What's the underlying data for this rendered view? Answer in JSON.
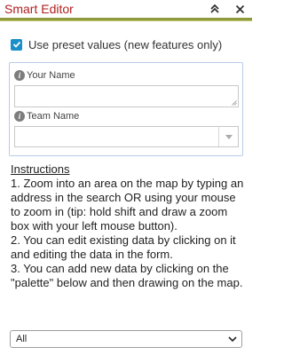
{
  "header": {
    "title": "Smart Editor",
    "collapse_icon": "double-chevron-up-icon",
    "close_icon": "close-icon",
    "accent_color": "#8e9a3b",
    "title_color": "#b11e1e"
  },
  "preset": {
    "checked": true,
    "label": "Use preset values (new features only)",
    "checkbox_color": "#1a8fc9"
  },
  "fields": {
    "your_name": {
      "label": "Your Name",
      "value": "",
      "icon": "info-icon"
    },
    "team_name": {
      "label": "Team Name",
      "value": "",
      "icon": "info-icon"
    }
  },
  "instructions": {
    "title": "Instructions",
    "paragraphs": [
      "1. Zoom into an area on the map by typing an address in the search OR using your mouse to zoom in (tip: hold shift and draw a zoom box with your left mouse button).",
      "2. You can edit existing data by clicking on it and editing the data in the form.",
      "3. You can add new data by clicking on the \"palette\" below and then drawing on the map."
    ]
  },
  "filter": {
    "selected": "All"
  }
}
